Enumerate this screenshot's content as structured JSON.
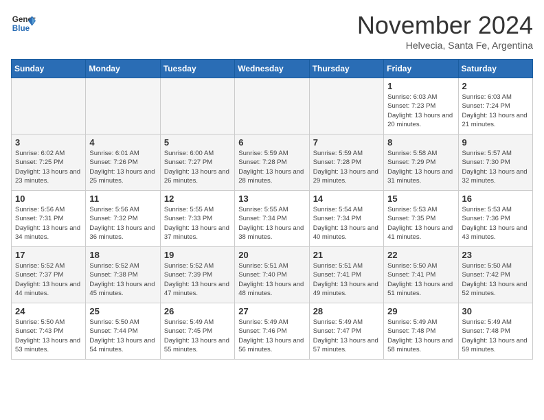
{
  "header": {
    "logo_general": "General",
    "logo_blue": "Blue",
    "month_title": "November 2024",
    "subtitle": "Helvecia, Santa Fe, Argentina"
  },
  "weekdays": [
    "Sunday",
    "Monday",
    "Tuesday",
    "Wednesday",
    "Thursday",
    "Friday",
    "Saturday"
  ],
  "weeks": [
    [
      {
        "day": "",
        "empty": true
      },
      {
        "day": "",
        "empty": true
      },
      {
        "day": "",
        "empty": true
      },
      {
        "day": "",
        "empty": true
      },
      {
        "day": "",
        "empty": true
      },
      {
        "day": "1",
        "sunrise": "6:03 AM",
        "sunset": "7:23 PM",
        "daylight": "13 hours and 20 minutes."
      },
      {
        "day": "2",
        "sunrise": "6:03 AM",
        "sunset": "7:24 PM",
        "daylight": "13 hours and 21 minutes."
      }
    ],
    [
      {
        "day": "3",
        "sunrise": "6:02 AM",
        "sunset": "7:25 PM",
        "daylight": "13 hours and 23 minutes."
      },
      {
        "day": "4",
        "sunrise": "6:01 AM",
        "sunset": "7:26 PM",
        "daylight": "13 hours and 25 minutes."
      },
      {
        "day": "5",
        "sunrise": "6:00 AM",
        "sunset": "7:27 PM",
        "daylight": "13 hours and 26 minutes."
      },
      {
        "day": "6",
        "sunrise": "5:59 AM",
        "sunset": "7:28 PM",
        "daylight": "13 hours and 28 minutes."
      },
      {
        "day": "7",
        "sunrise": "5:59 AM",
        "sunset": "7:28 PM",
        "daylight": "13 hours and 29 minutes."
      },
      {
        "day": "8",
        "sunrise": "5:58 AM",
        "sunset": "7:29 PM",
        "daylight": "13 hours and 31 minutes."
      },
      {
        "day": "9",
        "sunrise": "5:57 AM",
        "sunset": "7:30 PM",
        "daylight": "13 hours and 32 minutes."
      }
    ],
    [
      {
        "day": "10",
        "sunrise": "5:56 AM",
        "sunset": "7:31 PM",
        "daylight": "13 hours and 34 minutes."
      },
      {
        "day": "11",
        "sunrise": "5:56 AM",
        "sunset": "7:32 PM",
        "daylight": "13 hours and 36 minutes."
      },
      {
        "day": "12",
        "sunrise": "5:55 AM",
        "sunset": "7:33 PM",
        "daylight": "13 hours and 37 minutes."
      },
      {
        "day": "13",
        "sunrise": "5:55 AM",
        "sunset": "7:34 PM",
        "daylight": "13 hours and 38 minutes."
      },
      {
        "day": "14",
        "sunrise": "5:54 AM",
        "sunset": "7:34 PM",
        "daylight": "13 hours and 40 minutes."
      },
      {
        "day": "15",
        "sunrise": "5:53 AM",
        "sunset": "7:35 PM",
        "daylight": "13 hours and 41 minutes."
      },
      {
        "day": "16",
        "sunrise": "5:53 AM",
        "sunset": "7:36 PM",
        "daylight": "13 hours and 43 minutes."
      }
    ],
    [
      {
        "day": "17",
        "sunrise": "5:52 AM",
        "sunset": "7:37 PM",
        "daylight": "13 hours and 44 minutes."
      },
      {
        "day": "18",
        "sunrise": "5:52 AM",
        "sunset": "7:38 PM",
        "daylight": "13 hours and 45 minutes."
      },
      {
        "day": "19",
        "sunrise": "5:52 AM",
        "sunset": "7:39 PM",
        "daylight": "13 hours and 47 minutes."
      },
      {
        "day": "20",
        "sunrise": "5:51 AM",
        "sunset": "7:40 PM",
        "daylight": "13 hours and 48 minutes."
      },
      {
        "day": "21",
        "sunrise": "5:51 AM",
        "sunset": "7:41 PM",
        "daylight": "13 hours and 49 minutes."
      },
      {
        "day": "22",
        "sunrise": "5:50 AM",
        "sunset": "7:41 PM",
        "daylight": "13 hours and 51 minutes."
      },
      {
        "day": "23",
        "sunrise": "5:50 AM",
        "sunset": "7:42 PM",
        "daylight": "13 hours and 52 minutes."
      }
    ],
    [
      {
        "day": "24",
        "sunrise": "5:50 AM",
        "sunset": "7:43 PM",
        "daylight": "13 hours and 53 minutes."
      },
      {
        "day": "25",
        "sunrise": "5:50 AM",
        "sunset": "7:44 PM",
        "daylight": "13 hours and 54 minutes."
      },
      {
        "day": "26",
        "sunrise": "5:49 AM",
        "sunset": "7:45 PM",
        "daylight": "13 hours and 55 minutes."
      },
      {
        "day": "27",
        "sunrise": "5:49 AM",
        "sunset": "7:46 PM",
        "daylight": "13 hours and 56 minutes."
      },
      {
        "day": "28",
        "sunrise": "5:49 AM",
        "sunset": "7:47 PM",
        "daylight": "13 hours and 57 minutes."
      },
      {
        "day": "29",
        "sunrise": "5:49 AM",
        "sunset": "7:48 PM",
        "daylight": "13 hours and 58 minutes."
      },
      {
        "day": "30",
        "sunrise": "5:49 AM",
        "sunset": "7:48 PM",
        "daylight": "13 hours and 59 minutes."
      }
    ]
  ]
}
